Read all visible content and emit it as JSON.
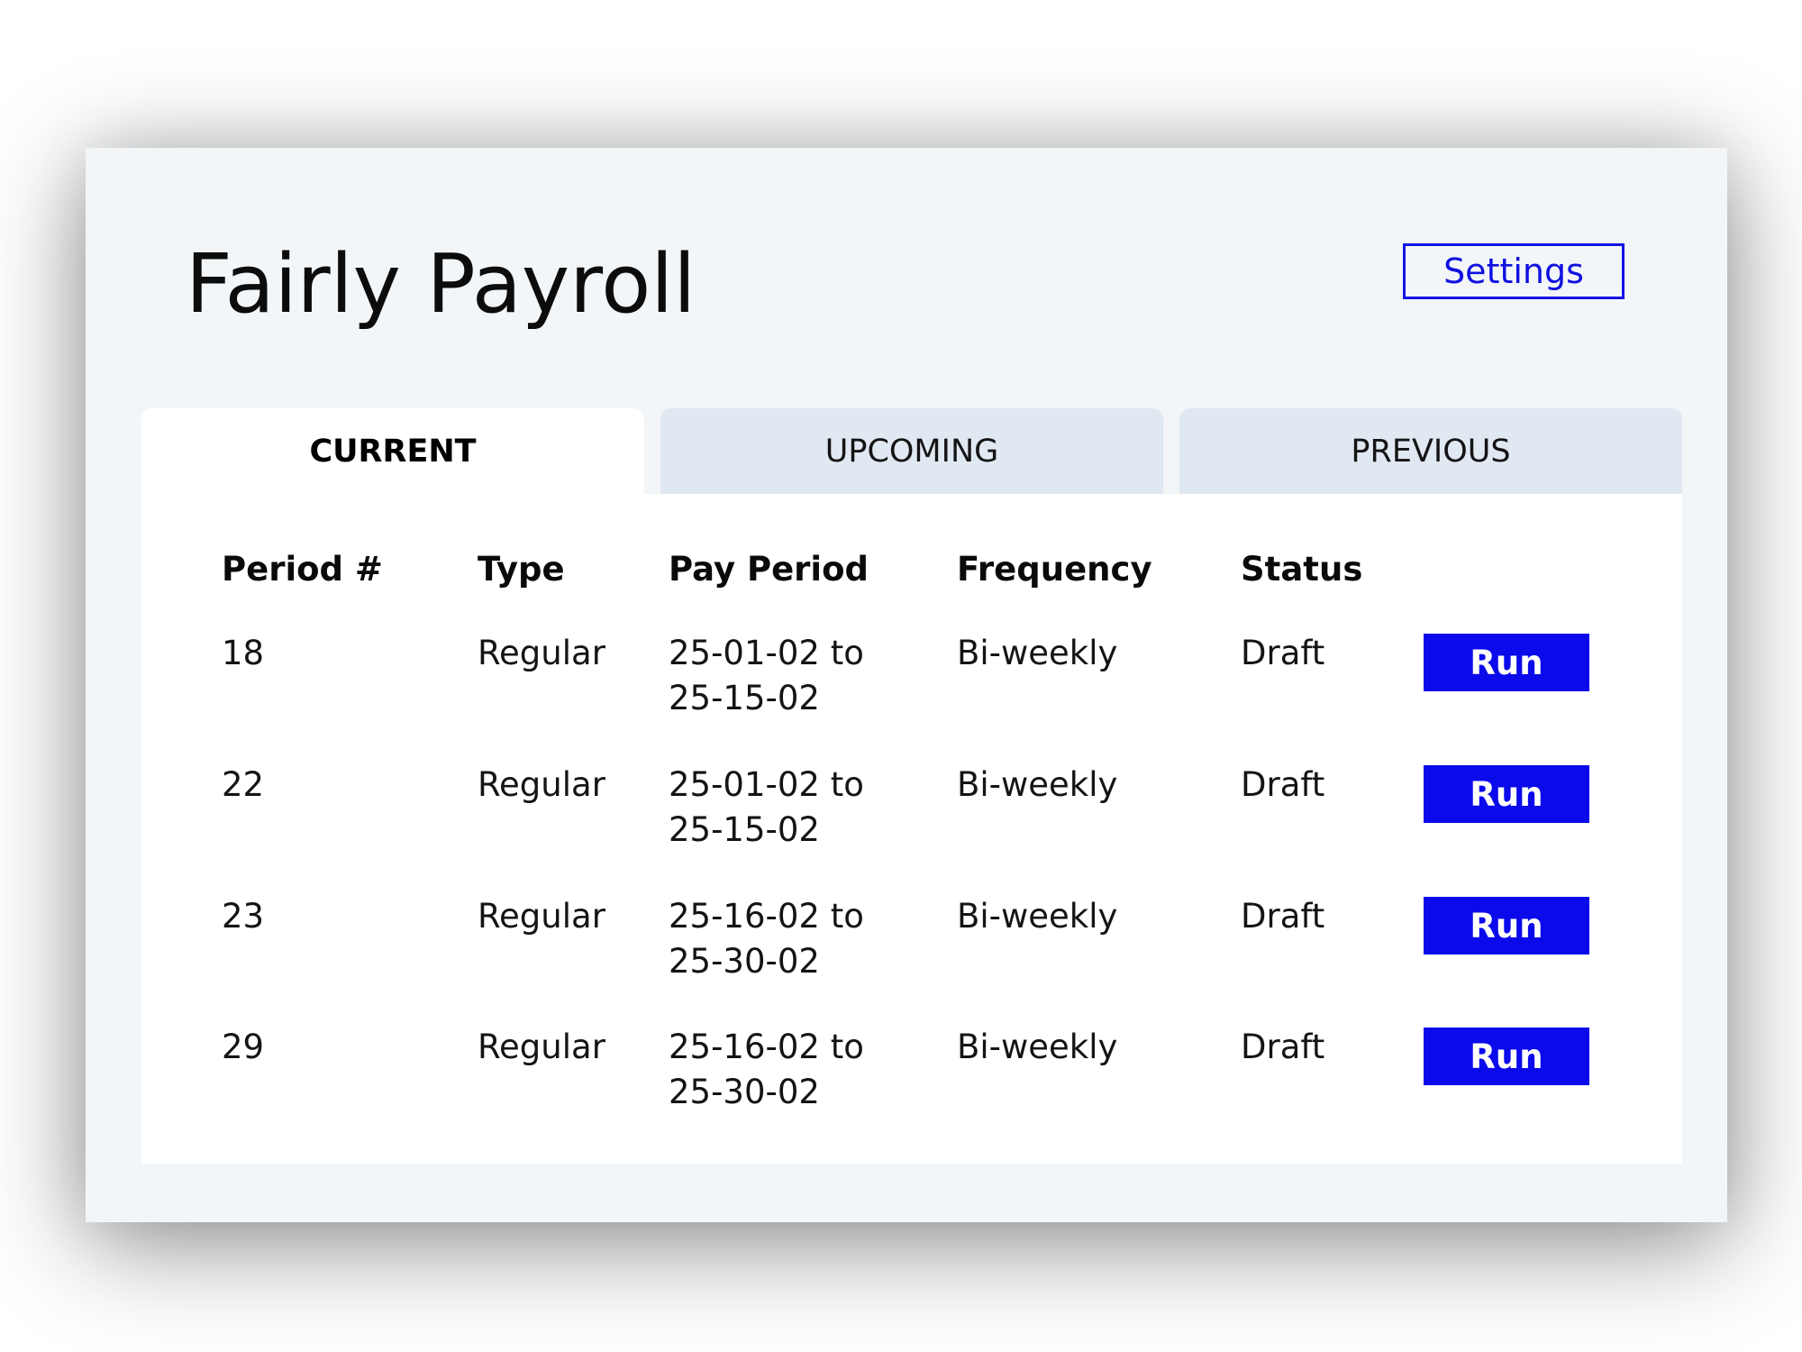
{
  "app": {
    "title": "Fairly Payroll",
    "settings_label": "Settings"
  },
  "tabs": [
    {
      "label": "CURRENT",
      "active": true
    },
    {
      "label": "UPCOMING",
      "active": false
    },
    {
      "label": "PREVIOUS",
      "active": false
    }
  ],
  "table": {
    "headers": {
      "period": "Period #",
      "type": "Type",
      "pay_period": "Pay Period",
      "frequency": "Frequency",
      "status": "Status"
    },
    "rows": [
      {
        "period": "18",
        "type": "Regular",
        "pay_period_start": "25-01-02 to",
        "pay_period_end": "25-15-02",
        "frequency": "Bi-weekly",
        "status": "Draft",
        "action": "Run"
      },
      {
        "period": "22",
        "type": "Regular",
        "pay_period_start": "25-01-02 to",
        "pay_period_end": "25-15-02",
        "frequency": "Bi-weekly",
        "status": "Draft",
        "action": "Run"
      },
      {
        "period": "23",
        "type": "Regular",
        "pay_period_start": "25-16-02 to",
        "pay_period_end": "25-30-02",
        "frequency": "Bi-weekly",
        "status": "Draft",
        "action": "Run"
      },
      {
        "period": "29",
        "type": "Regular",
        "pay_period_start": "25-16-02 to",
        "pay_period_end": "25-30-02",
        "frequency": "Bi-weekly",
        "status": "Draft",
        "action": "Run"
      }
    ]
  },
  "colors": {
    "accent": "#0a0aeb",
    "window_bg": "#f2f6f9",
    "inactive_tab": "#e0e8f1"
  }
}
